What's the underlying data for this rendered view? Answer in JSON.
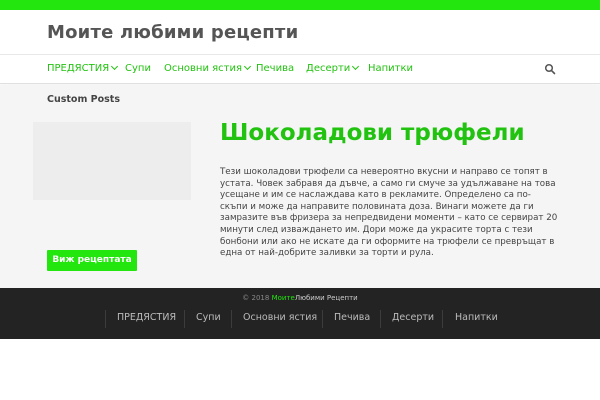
{
  "site": {
    "title": "Моите любими рецепти"
  },
  "nav": {
    "items": [
      {
        "label": "ПРЕДЯСТИЯ",
        "has_dropdown": true
      },
      {
        "label": "Супи",
        "has_dropdown": false
      },
      {
        "label": "Основни ястия",
        "has_dropdown": true
      },
      {
        "label": "Печива",
        "has_dropdown": false
      },
      {
        "label": "Десерти",
        "has_dropdown": true
      },
      {
        "label": "Напитки",
        "has_dropdown": false
      }
    ],
    "search_icon": "search-icon"
  },
  "main": {
    "section_label": "Custom Posts",
    "post": {
      "title": "Шоколадови трюфели",
      "body": "Тези шоколадови трюфели са невероятно вкусни и направо се топят в устата. Човек забравя да дъвче, а само ги смуче за удължаване на това усещане и им се наслаждава като в рекламите. Определено са по-скъпи и може да направите половината доза. Винаги можете да ги замразите във фризера за непредвидени моменти – като се сервират 20 минути след изваждането им. Дори може да украсите торта с тези бонбони или ако не искате да ги оформите на трюфели се превръщат в една от най-добрите заливки за торти и рула.",
      "button_label": "Виж рецептата"
    }
  },
  "footer": {
    "copyright_prefix": "© 2018",
    "copyright_brand": "Моите",
    "copyright_rest": "Любими Рецепти",
    "nav": [
      "ПРЕДЯСТИЯ",
      "Супи",
      "Основни ястия",
      "Печива",
      "Десерти",
      "Напитки"
    ]
  },
  "colors": {
    "accent": "#22e60d",
    "link": "#22c210",
    "footer_bg": "#232323"
  }
}
